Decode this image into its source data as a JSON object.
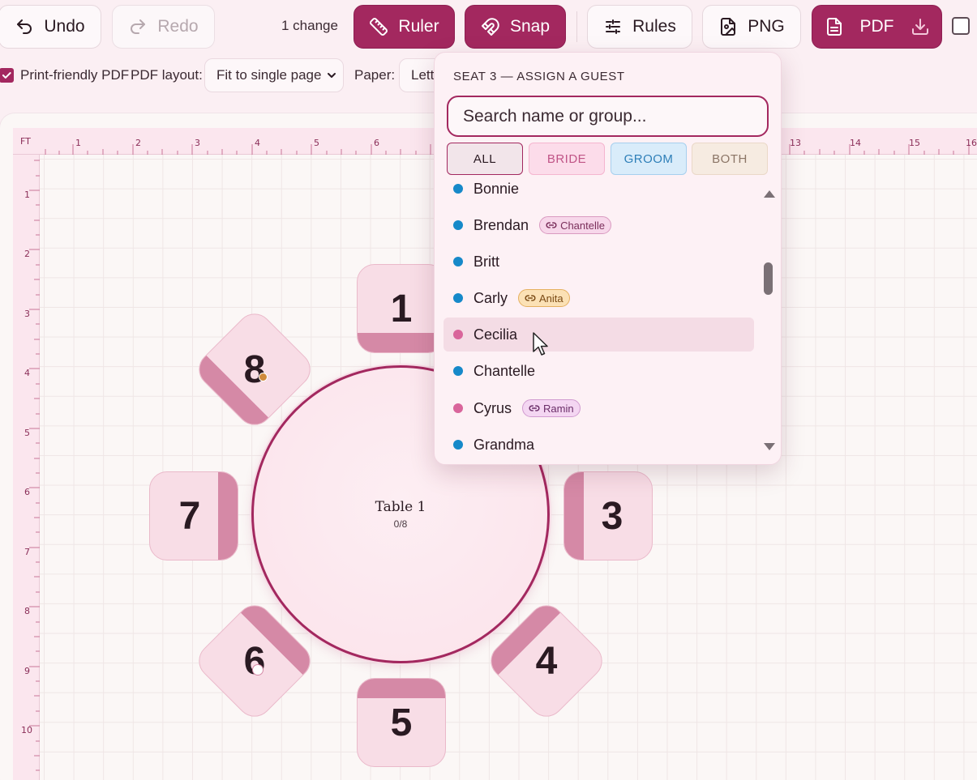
{
  "toolbar": {
    "undo_label": "Undo",
    "redo_label": "Redo",
    "changes_text": "1 change",
    "ruler_label": "Ruler",
    "snap_label": "Snap",
    "rules_label": "Rules",
    "png_label": "PNG",
    "pdf_label": "PDF"
  },
  "options": {
    "print_friendly_label": "Print-friendly PDF",
    "print_friendly_checked": true,
    "pdf_layout_label": "PDF layout:",
    "pdf_layout_value": "Fit to single page",
    "paper_label": "Paper:",
    "paper_value": "Lett"
  },
  "ruler": {
    "unit": "FT",
    "x_ticks": [
      "1",
      "2",
      "3",
      "4",
      "5",
      "6",
      "13",
      "14",
      "15",
      "16"
    ],
    "y_ticks": [
      "1",
      "2",
      "3",
      "4",
      "5",
      "6",
      "7",
      "8",
      "9",
      "10"
    ]
  },
  "table": {
    "name": "Table 1",
    "count": "0/8"
  },
  "seats": [
    "1",
    "3",
    "4",
    "5",
    "6",
    "7",
    "8"
  ],
  "popover": {
    "title": "SEAT 3 — ASSIGN A GUEST",
    "search_placeholder": "Search name or group...",
    "filters": [
      {
        "label": "ALL",
        "active": true
      },
      {
        "label": "BRIDE",
        "active": false
      },
      {
        "label": "GROOM",
        "active": false
      },
      {
        "label": "BOTH",
        "active": false
      }
    ],
    "guests": [
      {
        "name": "Bonnie",
        "side": "groom",
        "link": ""
      },
      {
        "name": "Brendan",
        "side": "groom",
        "link": "Chantelle"
      },
      {
        "name": "Britt",
        "side": "groom",
        "link": ""
      },
      {
        "name": "Carly",
        "side": "groom",
        "link": "Anita"
      },
      {
        "name": "Cecilia",
        "side": "bride",
        "link": ""
      },
      {
        "name": "Chantelle",
        "side": "groom",
        "link": ""
      },
      {
        "name": "Cyrus",
        "side": "bride",
        "link": "Ramin"
      },
      {
        "name": "Grandma",
        "side": "groom",
        "link": ""
      }
    ]
  },
  "colors": {
    "accent": "#a3285f",
    "groom_dot": "#1689c9",
    "bride_dot": "#d9659b",
    "seat_fill": "#f8dde6",
    "seat_band": "#d589a6"
  }
}
